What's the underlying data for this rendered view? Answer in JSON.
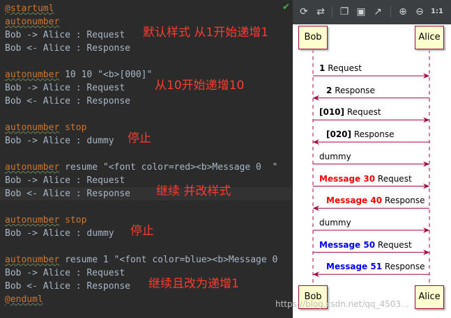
{
  "editor": {
    "lines": [
      {
        "segments": [
          {
            "text": "@startuml",
            "cls": "kw sq"
          }
        ]
      },
      {
        "segments": [
          {
            "text": "autonumber",
            "cls": "kw sq"
          }
        ]
      },
      {
        "segments": [
          {
            "text": "Bob -> Alice : Request",
            "cls": ""
          }
        ]
      },
      {
        "segments": [
          {
            "text": "Bob <- Alice : Response",
            "cls": ""
          }
        ]
      },
      {
        "segments": []
      },
      {
        "segments": [
          {
            "text": "autonumber",
            "cls": "kw sq"
          },
          {
            "text": " 10 10 \"<b>[000]\"",
            "cls": ""
          }
        ]
      },
      {
        "segments": [
          {
            "text": "Bob -> Alice : Request",
            "cls": ""
          }
        ]
      },
      {
        "segments": [
          {
            "text": "Bob <- Alice : Response",
            "cls": ""
          }
        ]
      },
      {
        "segments": []
      },
      {
        "segments": [
          {
            "text": "autonumber",
            "cls": "kw sq"
          },
          {
            "text": " stop",
            "cls": "kw"
          }
        ]
      },
      {
        "segments": [
          {
            "text": "Bob -> Alice : dummy",
            "cls": ""
          }
        ]
      },
      {
        "segments": []
      },
      {
        "segments": [
          {
            "text": "autonumber",
            "cls": "kw sq"
          },
          {
            "text": " resume \"<font color=red><b>Message 0  \"",
            "cls": ""
          }
        ]
      },
      {
        "segments": [
          {
            "text": "Bob -> Alice : Request",
            "cls": ""
          }
        ]
      },
      {
        "segments": [
          {
            "text": "Bob <- Alice : Response",
            "cls": ""
          }
        ]
      },
      {
        "segments": []
      },
      {
        "segments": [
          {
            "text": "autonumber",
            "cls": "kw sq"
          },
          {
            "text": " stop",
            "cls": "kw"
          }
        ]
      },
      {
        "segments": [
          {
            "text": "Bob -> Alice : dummy",
            "cls": ""
          }
        ]
      },
      {
        "segments": []
      },
      {
        "segments": [
          {
            "text": "autonumber",
            "cls": "kw sq"
          },
          {
            "text": " resume 1 \"<font color=blue><b>Message 0",
            "cls": ""
          }
        ]
      },
      {
        "segments": [
          {
            "text": "Bob -> Alice : Request",
            "cls": ""
          }
        ]
      },
      {
        "segments": [
          {
            "text": "Bob <- Alice : Response",
            "cls": ""
          }
        ]
      },
      {
        "segments": [
          {
            "text": "@enduml",
            "cls": "kw sq"
          }
        ]
      }
    ],
    "annotations": [
      {
        "text": "默认样式 从1开始递增1",
        "line": 2
      },
      {
        "text": "从10开始递增10",
        "line": 6
      },
      {
        "text": "停止",
        "line": 10
      },
      {
        "text": "继续 并改样式",
        "line": 14
      },
      {
        "text": "停止",
        "line": 17
      },
      {
        "text": "继续且改为递增1",
        "line": 21
      }
    ]
  },
  "toolbar": {
    "buttons": [
      {
        "name": "refresh-icon",
        "glyph": "⟳"
      },
      {
        "name": "sync-icon",
        "glyph": "⇄"
      },
      {
        "name": "copy-icon",
        "glyph": "❐"
      },
      {
        "name": "save-icon",
        "glyph": "▣"
      },
      {
        "name": "export-icon",
        "glyph": "↗"
      },
      {
        "name": "zoom-in-icon",
        "glyph": "⊕"
      },
      {
        "name": "zoom-out-icon",
        "glyph": "⊖"
      },
      {
        "name": "actual-size-icon",
        "glyph": "1:1"
      }
    ]
  },
  "diagram": {
    "participants": [
      "Bob",
      "Alice"
    ],
    "messages": [
      {
        "dir": "right",
        "num": "1",
        "text": "Request",
        "num_color": "#000000"
      },
      {
        "dir": "left",
        "num": "2",
        "text": "Response",
        "num_color": "#000000"
      },
      {
        "dir": "right",
        "num": "[010]",
        "text": "Request",
        "num_color": "#000000"
      },
      {
        "dir": "left",
        "num": "[020]",
        "text": "Response",
        "num_color": "#000000"
      },
      {
        "dir": "right",
        "num": "",
        "text": "dummy",
        "num_color": "#000000"
      },
      {
        "dir": "right",
        "num": "Message 30",
        "text": "Request",
        "num_color": "#ff0000"
      },
      {
        "dir": "left",
        "num": "Message 40",
        "text": "Response",
        "num_color": "#ff0000"
      },
      {
        "dir": "right",
        "num": "",
        "text": "dummy",
        "num_color": "#000000"
      },
      {
        "dir": "right",
        "num": "Message 50",
        "text": "Request",
        "num_color": "#0000ff"
      },
      {
        "dir": "left",
        "num": "Message 51",
        "text": "Response",
        "num_color": "#0000ff"
      }
    ],
    "line_color": "#a80036",
    "box_fill": "#fefece"
  },
  "watermark": "https://blog.csdn.net/qq_4503..."
}
